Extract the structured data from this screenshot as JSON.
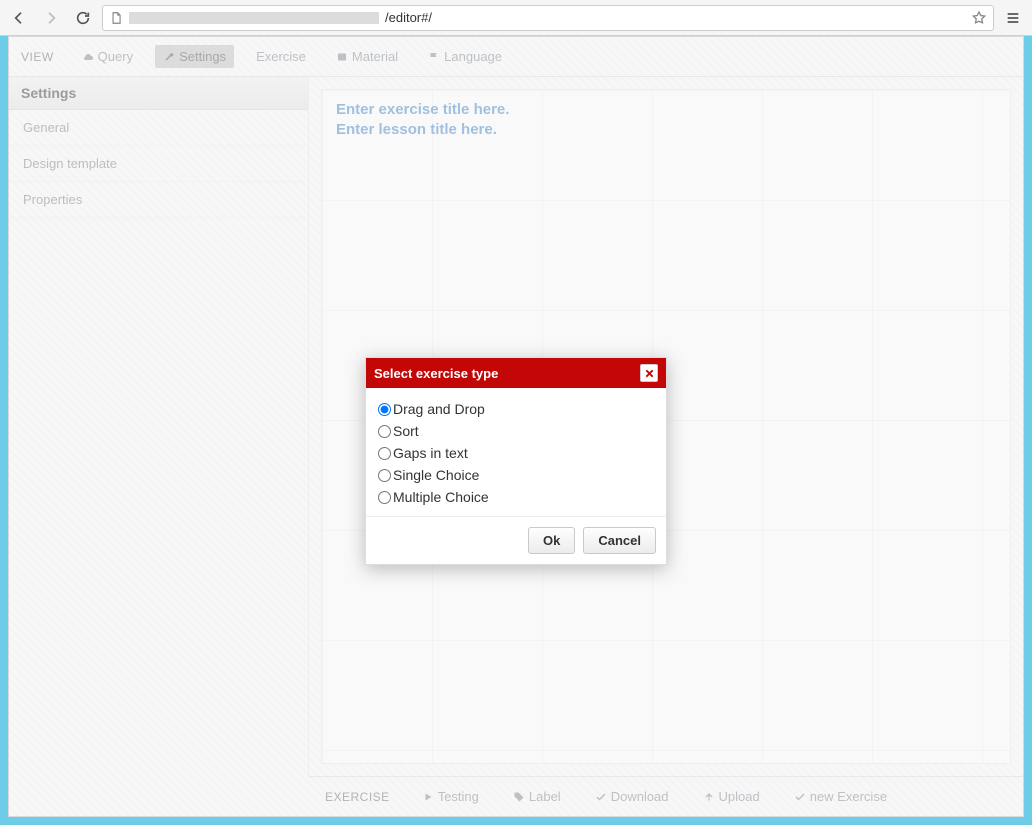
{
  "chrome": {
    "url_visible": "/editor#/"
  },
  "top_toolbar": {
    "view_label": "VIEW",
    "items": [
      {
        "label": "Query"
      },
      {
        "label": "Settings"
      },
      {
        "label": "Exercise"
      },
      {
        "label": "Material"
      },
      {
        "label": "Language"
      }
    ]
  },
  "sidebar": {
    "title": "Settings",
    "items": [
      {
        "label": "General"
      },
      {
        "label": "Design template"
      },
      {
        "label": "Properties"
      }
    ]
  },
  "canvas": {
    "exercise_title_placeholder": "Enter exercise title here.",
    "lesson_title_placeholder": "Enter lesson title here."
  },
  "bottom_toolbar": {
    "view_label": "EXERCISE",
    "items": [
      {
        "label": "Testing"
      },
      {
        "label": "Label"
      },
      {
        "label": "Download"
      },
      {
        "label": "Upload"
      },
      {
        "label": "new Exercise"
      }
    ]
  },
  "modal": {
    "title": "Select exercise type",
    "options": [
      {
        "label": "Drag and Drop",
        "selected": true
      },
      {
        "label": "Sort",
        "selected": false
      },
      {
        "label": "Gaps in text",
        "selected": false
      },
      {
        "label": "Single Choice",
        "selected": false
      },
      {
        "label": "Multiple Choice",
        "selected": false
      }
    ],
    "ok_label": "Ok",
    "cancel_label": "Cancel"
  }
}
